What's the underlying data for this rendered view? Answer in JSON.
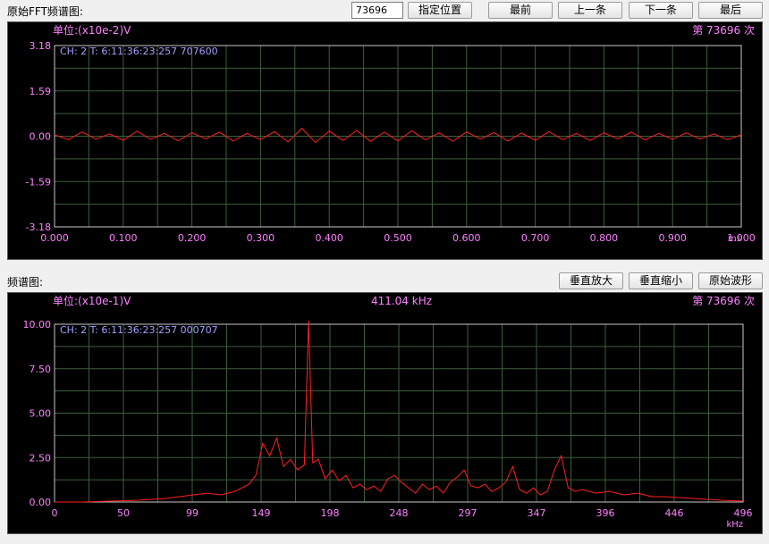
{
  "top": {
    "title": "原始FFT频谱图:",
    "record_input": "73696",
    "btn_goto": "指定位置",
    "btn_first": "最前",
    "btn_prev": "上一条",
    "btn_next": "下一条",
    "btn_last": "最后"
  },
  "spectrum_section": {
    "title": "频谱图:",
    "btn_zoom_in": "垂直放大",
    "btn_zoom_out": "垂直缩小",
    "btn_raw": "原始波形"
  },
  "colors": {
    "panel_bg": "#000000",
    "grid": "#3c5e3c",
    "axis_label": "#ff80ff",
    "info_text": "#9fa0ff",
    "trace": "#ff1e1e"
  },
  "chart_data": [
    {
      "type": "line",
      "unit_text": "单位:(x10e-2)V",
      "count_text": "第 73696 次",
      "info_text": "CH:  2  T:  6:11:36:23:257 707600",
      "xunit": "ms",
      "ylim": [
        -3.18,
        3.18
      ],
      "xlim": [
        0,
        1
      ],
      "ytick_labels": [
        "3.18",
        "1.59",
        "0.00",
        "-1.59",
        "-3.18"
      ],
      "xtick_labels": [
        "0.000",
        "0.100",
        "0.200",
        "0.300",
        "0.400",
        "0.500",
        "0.600",
        "0.700",
        "0.800",
        "0.900",
        "1.000"
      ],
      "grid": true,
      "series": [
        {
          "x": [
            0,
            0.02,
            0.04,
            0.06,
            0.08,
            0.1,
            0.12,
            0.14,
            0.16,
            0.18,
            0.2,
            0.22,
            0.24,
            0.26,
            0.28,
            0.3,
            0.32,
            0.34,
            0.36,
            0.38,
            0.4,
            0.42,
            0.44,
            0.46,
            0.48,
            0.5,
            0.52,
            0.54,
            0.56,
            0.58,
            0.6,
            0.62,
            0.64,
            0.66,
            0.68,
            0.7,
            0.72,
            0.74,
            0.76,
            0.78,
            0.8,
            0.82,
            0.84,
            0.86,
            0.88,
            0.9,
            0.92,
            0.94,
            0.96,
            0.98,
            1.0
          ],
          "y": [
            0.05,
            -0.12,
            0.15,
            -0.1,
            0.08,
            -0.14,
            0.18,
            -0.11,
            0.1,
            -0.16,
            0.12,
            -0.09,
            0.14,
            -0.17,
            0.1,
            -0.12,
            0.16,
            -0.2,
            0.28,
            -0.22,
            0.18,
            -0.15,
            0.2,
            -0.18,
            0.14,
            -0.16,
            0.19,
            -0.13,
            0.12,
            -0.18,
            0.15,
            -0.1,
            0.13,
            -0.17,
            0.11,
            -0.14,
            0.16,
            -0.12,
            0.1,
            -0.15,
            0.12,
            -0.09,
            0.14,
            -0.13,
            0.1,
            -0.11,
            0.12,
            -0.1,
            0.08,
            -0.12,
            0.05
          ]
        }
      ]
    },
    {
      "type": "line",
      "unit_text": "单位:(x10e-1)V",
      "peak_text": "411.04 kHz",
      "count_text": "第 73696 次",
      "info_text": "CH:  2  T:  6:11:36:23:257 000707",
      "xunit": "kHz",
      "ylim": [
        0,
        10
      ],
      "xlim": [
        0,
        496
      ],
      "ytick_labels": [
        "10.00",
        "7.50",
        "5.00",
        "2.50",
        "0.00"
      ],
      "xtick_labels": [
        "0",
        "50",
        "99",
        "149",
        "198",
        "248",
        "297",
        "347",
        "396",
        "446",
        "496"
      ],
      "grid": true,
      "series": [
        {
          "x": [
            0,
            20,
            40,
            60,
            80,
            90,
            100,
            110,
            120,
            130,
            140,
            145,
            150,
            155,
            160,
            165,
            170,
            175,
            180,
            183,
            186,
            190,
            195,
            200,
            205,
            210,
            215,
            220,
            225,
            230,
            235,
            240,
            245,
            250,
            255,
            260,
            265,
            270,
            275,
            280,
            285,
            290,
            295,
            300,
            305,
            310,
            315,
            320,
            325,
            330,
            335,
            340,
            345,
            350,
            355,
            360,
            365,
            370,
            375,
            380,
            390,
            400,
            410,
            420,
            430,
            440,
            460,
            480,
            496
          ],
          "y": [
            0,
            0,
            0.05,
            0.1,
            0.2,
            0.3,
            0.4,
            0.5,
            0.4,
            0.6,
            1.0,
            1.5,
            3.3,
            2.6,
            3.6,
            2.0,
            2.4,
            1.8,
            2.1,
            10.2,
            2.2,
            2.4,
            1.3,
            1.8,
            1.2,
            1.5,
            0.8,
            1.0,
            0.7,
            0.9,
            0.6,
            1.3,
            1.5,
            1.1,
            0.8,
            0.5,
            1.0,
            0.7,
            0.9,
            0.5,
            1.1,
            1.4,
            1.8,
            0.9,
            0.8,
            1.0,
            0.6,
            0.8,
            1.1,
            2.0,
            0.7,
            0.5,
            0.8,
            0.4,
            0.6,
            1.8,
            2.6,
            0.8,
            0.6,
            0.7,
            0.5,
            0.6,
            0.4,
            0.5,
            0.3,
            0.3,
            0.2,
            0.1,
            0.05
          ]
        }
      ]
    }
  ]
}
